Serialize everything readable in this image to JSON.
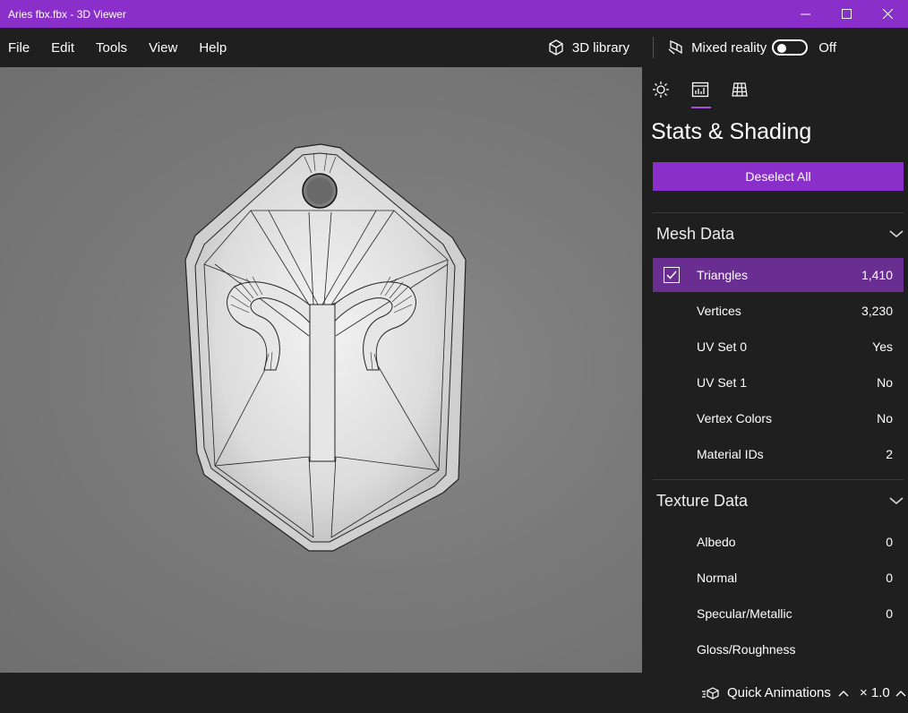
{
  "window": {
    "title": "Aries fbx.fbx - 3D Viewer"
  },
  "menu": {
    "items": [
      "File",
      "Edit",
      "Tools",
      "View",
      "Help"
    ]
  },
  "toolbar": {
    "library_label": "3D library",
    "mixed_reality_label": "Mixed reality",
    "mixed_reality_state": "Off"
  },
  "panel": {
    "tabs": [
      "lighting-icon",
      "stats-icon",
      "grid-icon"
    ],
    "active_tab": "stats-icon",
    "title": "Stats & Shading",
    "deselect_label": "Deselect All",
    "mesh": {
      "title": "Mesh Data",
      "rows": [
        {
          "label": "Triangles",
          "value": "1,410",
          "checked": true
        },
        {
          "label": "Vertices",
          "value": "3,230"
        },
        {
          "label": "UV Set 0",
          "value": "Yes"
        },
        {
          "label": "UV Set 1",
          "value": "No"
        },
        {
          "label": "Vertex Colors",
          "value": "No"
        },
        {
          "label": "Material IDs",
          "value": "2"
        }
      ]
    },
    "texture": {
      "title": "Texture Data",
      "rows": [
        {
          "label": "Albedo",
          "value": "0"
        },
        {
          "label": "Normal",
          "value": "0"
        },
        {
          "label": "Specular/Metallic",
          "value": "0"
        },
        {
          "label": "Gloss/Roughness",
          "value": ""
        }
      ]
    }
  },
  "bottom": {
    "animations_label": "Quick Animations",
    "speed": "× 1.0"
  },
  "colors": {
    "accent": "#8a2fc9",
    "selected_row": "#6a2e93",
    "background": "#1f1f1f"
  }
}
